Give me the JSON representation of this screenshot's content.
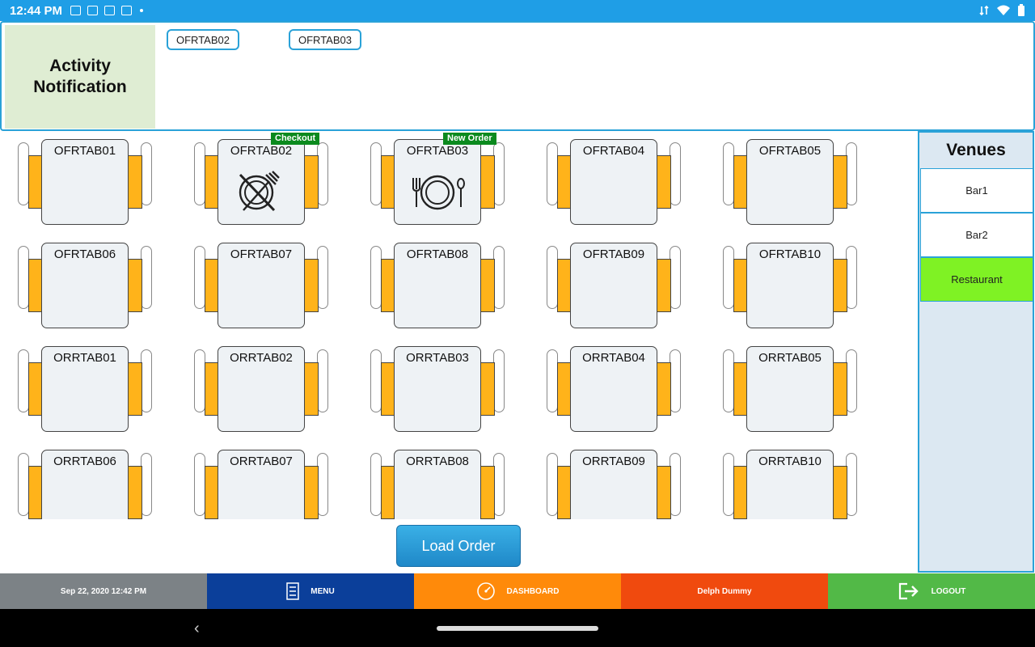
{
  "status": {
    "time": "12:44 PM"
  },
  "notification": {
    "label": "Activity Notification",
    "chips": [
      "OFRTAB02",
      "OFRTAB03"
    ]
  },
  "tables": [
    {
      "name": "OFRTAB01"
    },
    {
      "name": "OFRTAB02",
      "badge": "Checkout",
      "icon": "no-dining-icon"
    },
    {
      "name": "OFRTAB03",
      "badge": "New Order",
      "icon": "dining-icon"
    },
    {
      "name": "OFRTAB04"
    },
    {
      "name": "OFRTAB05"
    },
    {
      "name": "OFRTAB06"
    },
    {
      "name": "OFRTAB07"
    },
    {
      "name": "OFRTAB08"
    },
    {
      "name": "OFRTAB09"
    },
    {
      "name": "OFRTAB10"
    },
    {
      "name": "ORRTAB01"
    },
    {
      "name": "ORRTAB02"
    },
    {
      "name": "ORRTAB03"
    },
    {
      "name": "ORRTAB04"
    },
    {
      "name": "ORRTAB05"
    },
    {
      "name": "ORRTAB06"
    },
    {
      "name": "ORRTAB07"
    },
    {
      "name": "ORRTAB08"
    },
    {
      "name": "ORRTAB09"
    },
    {
      "name": "ORRTAB10"
    }
  ],
  "venues": {
    "title": "Venues",
    "items": [
      {
        "label": "Bar1",
        "active": false
      },
      {
        "label": "Bar2",
        "active": false
      },
      {
        "label": "Restaurant",
        "active": true
      }
    ]
  },
  "load_order_label": "Load Order",
  "bottom": {
    "date": "Sep 22, 2020 12:42 PM",
    "menu": "MENU",
    "dashboard": "DASHBOARD",
    "user": "Delph Dummy",
    "logout": "LOGOUT"
  },
  "colors": {
    "accent": "#2aa2d8",
    "chair": "#ffb31a",
    "badge": "#0b8a1e",
    "venue_active": "#7ff224"
  }
}
